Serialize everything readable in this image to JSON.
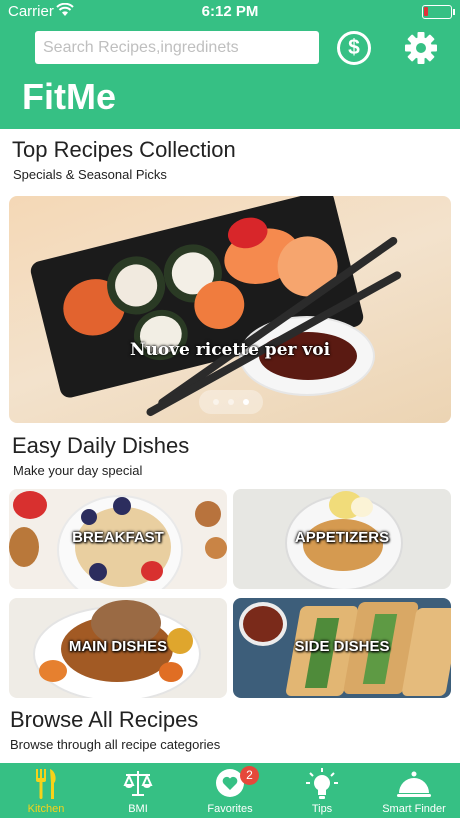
{
  "status_bar": {
    "carrier": "Carrier",
    "time": "6:12 PM",
    "battery_level": 0.15,
    "battery_color": "#e0323a"
  },
  "header": {
    "search_placeholder": "Search Recipes,ingredinets",
    "brand": "FitMe",
    "color": "#36c084",
    "icons": [
      "dollar-icon",
      "gear-icon"
    ]
  },
  "top_section": {
    "title": "Top Recipes Collection",
    "subtitle": "Specials & Seasonal Picks"
  },
  "banner": {
    "caption": "Nuove ricette per voi",
    "page_count": 3,
    "active_page": 3
  },
  "daily_section": {
    "title": "Easy Daily Dishes",
    "subtitle": "Make your day special"
  },
  "categories": [
    {
      "label": "BREAKFAST"
    },
    {
      "label": "APPETIZERS"
    },
    {
      "label": "MAIN DISHES"
    },
    {
      "label": "SIDE DISHES"
    }
  ],
  "browse_section": {
    "title": "Browse All Recipes",
    "subtitle": "Browse through all recipe categories"
  },
  "tabbar": {
    "active_color": "#f7d21a",
    "items": [
      {
        "label": "Kitchen",
        "icon": "fork-knife-icon",
        "active": true
      },
      {
        "label": "BMI",
        "icon": "scale-icon",
        "active": false
      },
      {
        "label": "Favorites",
        "icon": "heart-icon",
        "active": false,
        "badge": "2"
      },
      {
        "label": "Tips",
        "icon": "lightbulb-icon",
        "active": false
      },
      {
        "label": "Smart Finder",
        "icon": "cloche-icon",
        "active": false
      }
    ]
  }
}
